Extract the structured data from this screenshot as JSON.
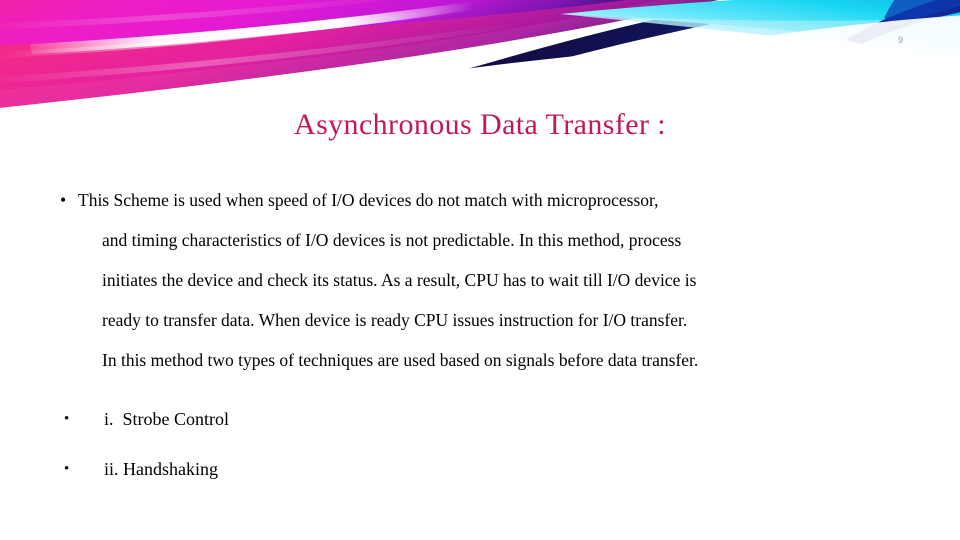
{
  "slide": {
    "page_number": "9",
    "title": "Asynchronous Data Transfer :",
    "title_color": "#c2185b",
    "background_color": "#ffffff",
    "text_color": "#000000"
  },
  "banner": {
    "name": "decorative-swoosh-banner",
    "colors": {
      "magenta": "#e61ad2",
      "hot_pink": "#f4308f",
      "crimson_pink": "#e8246b",
      "deep_purple": "#7b16b0",
      "violet": "#5a1a9e",
      "navy": "#0b1560",
      "dark_navy": "#10114a",
      "royal_blue": "#1653c8",
      "cyan": "#19d7f2",
      "light_cyan": "#8ef0fb",
      "white_streak": "#ffffff"
    }
  },
  "body": {
    "bullet_glyph": "•",
    "paragraph": {
      "lines": [
        "This Scheme is used when speed of I/O devices do not match with microprocessor,",
        "and timing characteristics of I/O devices is not predictable. In this method, process",
        "initiates the device and check its status. As a result, CPU has to wait till I/O device is",
        "ready to transfer data. When device is ready CPU issues instruction for I/O transfer.",
        "In this method two types of techniques are used based on signals before data transfer."
      ]
    },
    "sub_items": [
      {
        "label": "i.  Strobe Control"
      },
      {
        "label": "ii. Handshaking"
      }
    ]
  }
}
